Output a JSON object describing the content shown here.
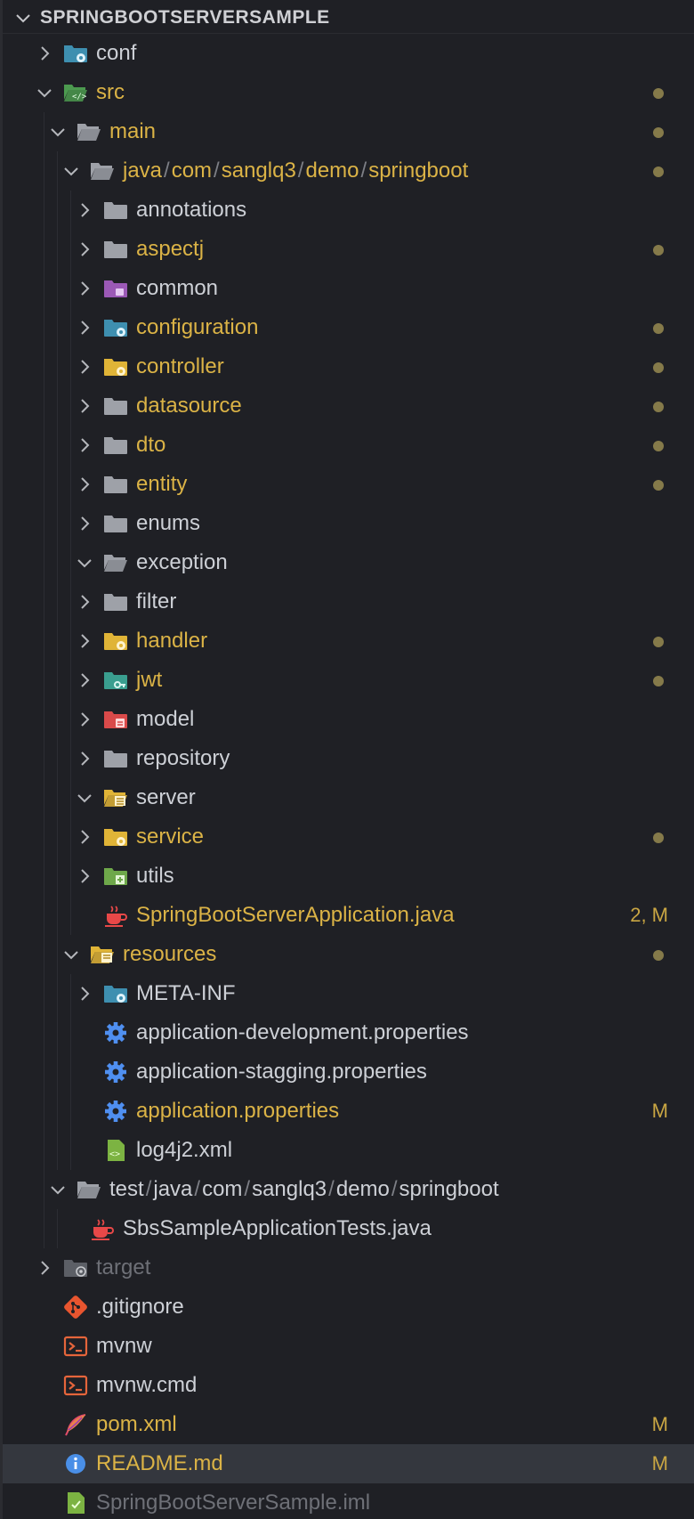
{
  "explorer": {
    "title": "SPRINGBOOTSERVERSAMPLE",
    "colors": {
      "modified": "#dbb346",
      "normal": "#cdd0d6",
      "ignored": "#6e7077",
      "badge": "#c9a643",
      "dot": "#857a4a"
    }
  },
  "tree": [
    {
      "label": "conf",
      "depth": 0,
      "chevron": "right",
      "icon": "folder-config-icon",
      "color": "white"
    },
    {
      "label": "src",
      "depth": 0,
      "chevron": "down",
      "icon": "folder-src-icon",
      "color": "mod",
      "dot": true
    },
    {
      "label": "main",
      "depth": 1,
      "chevron": "down",
      "icon": "folder-open-icon",
      "color": "mod",
      "dot": true
    },
    {
      "label": "java/com/sanglq3/demo/springboot",
      "parts": [
        "java",
        "com",
        "sanglq3",
        "demo",
        "springboot"
      ],
      "depth": 2,
      "chevron": "down",
      "icon": "folder-open-icon",
      "color": "mod",
      "dot": true
    },
    {
      "label": "annotations",
      "depth": 3,
      "chevron": "right",
      "icon": "folder-icon",
      "color": "white"
    },
    {
      "label": "aspectj",
      "depth": 3,
      "chevron": "right",
      "icon": "folder-icon",
      "color": "mod",
      "dot": true
    },
    {
      "label": "common",
      "depth": 3,
      "chevron": "right",
      "icon": "folder-common-icon",
      "color": "white"
    },
    {
      "label": "configuration",
      "depth": 3,
      "chevron": "right",
      "icon": "folder-config-icon",
      "color": "mod",
      "dot": true
    },
    {
      "label": "controller",
      "depth": 3,
      "chevron": "right",
      "icon": "folder-controller-icon",
      "color": "mod",
      "dot": true
    },
    {
      "label": "datasource",
      "depth": 3,
      "chevron": "right",
      "icon": "folder-icon",
      "color": "mod",
      "dot": true
    },
    {
      "label": "dto",
      "depth": 3,
      "chevron": "right",
      "icon": "folder-icon",
      "color": "mod",
      "dot": true
    },
    {
      "label": "entity",
      "depth": 3,
      "chevron": "right",
      "icon": "folder-icon",
      "color": "mod",
      "dot": true
    },
    {
      "label": "enums",
      "depth": 3,
      "chevron": "right",
      "icon": "folder-icon",
      "color": "white"
    },
    {
      "label": "exception",
      "depth": 3,
      "chevron": "down",
      "icon": "folder-open-icon",
      "color": "white"
    },
    {
      "label": "filter",
      "depth": 3,
      "chevron": "right",
      "icon": "folder-icon",
      "color": "white"
    },
    {
      "label": "handler",
      "depth": 3,
      "chevron": "right",
      "icon": "folder-controller-icon",
      "color": "mod",
      "dot": true
    },
    {
      "label": "jwt",
      "depth": 3,
      "chevron": "right",
      "icon": "folder-key-icon",
      "color": "mod",
      "dot": true
    },
    {
      "label": "model",
      "depth": 3,
      "chevron": "right",
      "icon": "folder-model-icon",
      "color": "white"
    },
    {
      "label": "repository",
      "depth": 3,
      "chevron": "right",
      "icon": "folder-icon",
      "color": "white"
    },
    {
      "label": "server",
      "depth": 3,
      "chevron": "down",
      "icon": "folder-server-icon",
      "color": "white"
    },
    {
      "label": "service",
      "depth": 3,
      "chevron": "right",
      "icon": "folder-controller-icon",
      "color": "mod",
      "dot": true
    },
    {
      "label": "utils",
      "depth": 3,
      "chevron": "right",
      "icon": "folder-utils-icon",
      "color": "white"
    },
    {
      "label": "SpringBootServerApplication.java",
      "depth": 3,
      "chevron": "none",
      "icon": "java-icon",
      "color": "mod",
      "badge": "2, M"
    },
    {
      "label": "resources",
      "depth": 2,
      "chevron": "down",
      "icon": "folder-resources-icon",
      "color": "mod",
      "dot": true
    },
    {
      "label": "META-INF",
      "depth": 3,
      "chevron": "right",
      "icon": "folder-config-icon",
      "color": "white"
    },
    {
      "label": "application-development.properties",
      "depth": 3,
      "chevron": "none",
      "icon": "gear-icon",
      "color": "white"
    },
    {
      "label": "application-stagging.properties",
      "depth": 3,
      "chevron": "none",
      "icon": "gear-icon",
      "color": "white"
    },
    {
      "label": "application.properties",
      "depth": 3,
      "chevron": "none",
      "icon": "gear-icon",
      "color": "mod",
      "badge": "M"
    },
    {
      "label": "log4j2.xml",
      "depth": 3,
      "chevron": "none",
      "icon": "xml-icon",
      "color": "white"
    },
    {
      "label": "test/java/com/sanglq3/demo/springboot",
      "parts": [
        "test",
        "java",
        "com",
        "sanglq3",
        "demo",
        "springboot"
      ],
      "depth": 1,
      "chevron": "down",
      "icon": "folder-open-icon",
      "color": "white"
    },
    {
      "label": "SbsSampleApplicationTests.java",
      "depth": 2,
      "chevron": "none",
      "icon": "java-icon",
      "color": "white"
    },
    {
      "label": "target",
      "depth": 0,
      "chevron": "right",
      "icon": "folder-target-icon",
      "color": "dim"
    },
    {
      "label": ".gitignore",
      "depth": 0,
      "chevron": "none",
      "icon": "git-icon",
      "color": "white"
    },
    {
      "label": "mvnw",
      "depth": 0,
      "chevron": "none",
      "icon": "terminal-icon",
      "color": "white"
    },
    {
      "label": "mvnw.cmd",
      "depth": 0,
      "chevron": "none",
      "icon": "terminal-icon",
      "color": "white"
    },
    {
      "label": "pom.xml",
      "depth": 0,
      "chevron": "none",
      "icon": "feather-icon",
      "color": "mod",
      "badge": "M"
    },
    {
      "label": "README.md",
      "depth": 0,
      "chevron": "none",
      "icon": "info-icon",
      "color": "mod",
      "badge": "M",
      "selected": true
    },
    {
      "label": "SpringBootServerSample.iml",
      "depth": 0,
      "chevron": "none",
      "icon": "iml-icon",
      "color": "dim"
    }
  ]
}
